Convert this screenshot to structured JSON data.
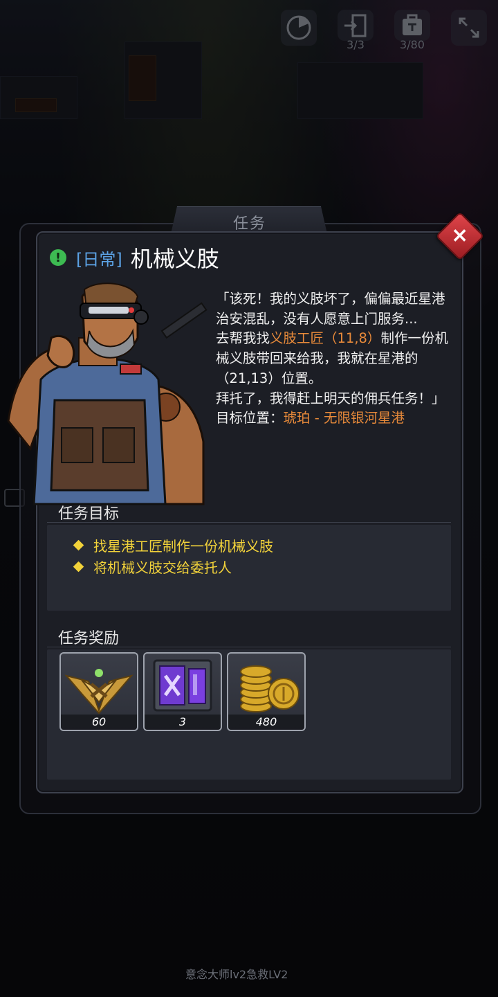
{
  "hud": {
    "items": [
      {
        "icon": "radar-icon",
        "count": ""
      },
      {
        "icon": "exit-door-icon",
        "count": "3/3"
      },
      {
        "icon": "backpack-icon",
        "count": "3/80"
      },
      {
        "icon": "expand-icon",
        "count": ""
      }
    ]
  },
  "dialog": {
    "tab_label": "任务",
    "close_label": "×",
    "quest_type": "[日常]",
    "quest_title": "机械义肢",
    "dialogue": {
      "p1": "「该死！我的义肢坏了，偏偏最近星港治安混乱，没有人愿意上门服务...",
      "p2_before": "去帮我找",
      "p2_highlight": "义肢工匠（11,8）",
      "p2_after": "制作一份机械义肢带回来给我，我就在星港的（21,13）位置。",
      "p3": "拜托了，我得赶上明天的佣兵任务！」",
      "target_label": "目标位置：",
      "target_value": "琥珀 - 无限银河星港"
    },
    "objectives_header": "任务目标",
    "objectives": [
      "找星港工匠制作一份机械义肢",
      "将机械义肢交给委托人"
    ],
    "rewards_header": "任务奖励",
    "rewards": [
      {
        "icon": "rank-badge-icon",
        "quantity": "60"
      },
      {
        "icon": "purple-crate-icon",
        "quantity": "3"
      },
      {
        "icon": "gold-coins-icon",
        "quantity": "480"
      }
    ]
  },
  "footer": {
    "skills_text": "意念大师lv2急救LV2"
  },
  "colors": {
    "highlight_orange": "#e88a3a",
    "objective_yellow": "#f2d23a",
    "quest_type_blue": "#5ca3e6",
    "close_red": "#d83a40"
  }
}
